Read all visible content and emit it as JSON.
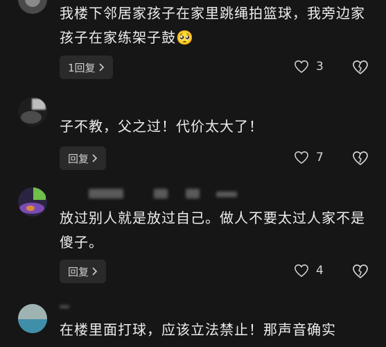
{
  "comments": [
    {
      "text": "我楼下邻居家孩子在家里跳绳拍篮球，我旁边家孩子在家练架子鼓",
      "emoji": "🥺",
      "reply_label": "1回复",
      "likes": "3"
    },
    {
      "text": "子不教，父之过！代价太大了！",
      "reply_label": "回复",
      "likes": "7"
    },
    {
      "text": "放过别人就是放过自己。做人不要太过人家不是傻子。",
      "reply_label": "回复",
      "likes": "4"
    },
    {
      "text": "在楼里面打球，应该立法禁止！那声音确实"
    }
  ],
  "icons": {
    "like": "heart-outline-icon",
    "dislike": "broken-heart-icon",
    "chevron": "chevron-right-icon"
  }
}
